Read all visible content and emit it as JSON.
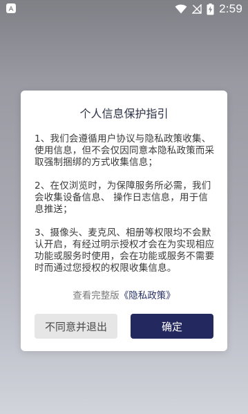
{
  "status_bar": {
    "time": "2:59",
    "left_icon": "a-icon",
    "icons": [
      "wifi-icon",
      "signal-off-icon",
      "battery-charging-icon"
    ]
  },
  "dialog": {
    "title": "个人信息保护指引",
    "paragraphs": [
      "1、我们会遵循用户协议与隐私政策收集、使用信息，但不会仅因同意本隐私政策而采取强制捆绑的方式收集信息；",
      "2、在仅浏览时，为保障服务所必需，我们会收集设备信息、 操作日志信息，用于信息推送；",
      "3、摄像头、麦克风、相册等权限均不会默认开启，有经过明示授权才会在为实现相应功能或服务时使用，会在功能或服务不需要时而通过您授权的权限收集信息。"
    ],
    "policy_prefix": "查看完整版",
    "policy_link": "《隐私政策》",
    "buttons": {
      "decline": "不同意并退出",
      "agree": "确定"
    }
  },
  "colors": {
    "accent": "#23295e",
    "link": "#283163",
    "decline_bg": "#e6e6e6"
  }
}
